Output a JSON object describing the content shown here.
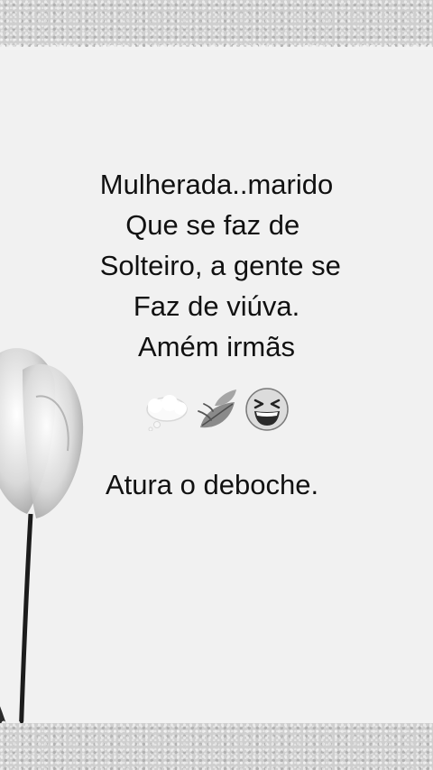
{
  "post": {
    "lines": [
      "Mulherada..marido",
      "Que se faz de ",
      " Solteiro, a gente se",
      "Faz de viúva.",
      "Amém irmãs"
    ],
    "closing": "Atura o deboche."
  },
  "emojis": [
    "thought-bubble-icon",
    "leaf-fluttering-icon",
    "laughing-face-icon"
  ],
  "colors": {
    "background": "#f2f2f2",
    "text": "#111111",
    "frame": "#cfcfcf"
  }
}
